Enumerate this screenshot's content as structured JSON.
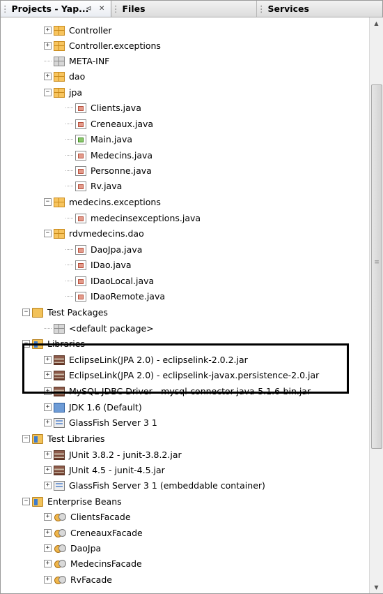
{
  "tabs": [
    {
      "label": "Projects - Yap...",
      "minimize": "⊲",
      "close": "✕"
    },
    {
      "label": "Files"
    },
    {
      "label": "Services"
    }
  ],
  "tree": [
    {
      "label": "Controller",
      "icon": "package-icon",
      "exp": "+"
    },
    {
      "label": "Controller.exceptions",
      "icon": "package-icon",
      "exp": "+"
    },
    {
      "label": "META-INF",
      "icon": "package-gray-icon",
      "exp": ""
    },
    {
      "label": "dao",
      "icon": "package-icon",
      "exp": "+"
    },
    {
      "label": "jpa",
      "icon": "package-icon",
      "exp": "−"
    },
    {
      "label": "Clients.java",
      "icon": "java-file-icon",
      "exp": ""
    },
    {
      "label": "Creneaux.java",
      "icon": "java-file-icon",
      "exp": ""
    },
    {
      "label": "Main.java",
      "icon": "java-main-file-icon",
      "exp": ""
    },
    {
      "label": "Medecins.java",
      "icon": "java-file-icon",
      "exp": ""
    },
    {
      "label": "Personne.java",
      "icon": "java-file-icon",
      "exp": ""
    },
    {
      "label": "Rv.java",
      "icon": "java-file-icon",
      "exp": ""
    },
    {
      "label": "medecins.exceptions",
      "icon": "package-icon",
      "exp": "−"
    },
    {
      "label": "medecinsexceptions.java",
      "icon": "java-file-icon",
      "exp": ""
    },
    {
      "label": "rdvmedecins.dao",
      "icon": "package-icon",
      "exp": "−"
    },
    {
      "label": "DaoJpa.java",
      "icon": "java-file-icon",
      "exp": ""
    },
    {
      "label": "IDao.java",
      "icon": "java-file-icon",
      "exp": ""
    },
    {
      "label": "IDaoLocal.java",
      "icon": "java-file-icon",
      "exp": ""
    },
    {
      "label": "IDaoRemote.java",
      "icon": "java-file-icon",
      "exp": ""
    },
    {
      "label": "Test Packages",
      "icon": "folder-icon",
      "exp": "−"
    },
    {
      "label": "<default package>",
      "icon": "package-gray-icon",
      "exp": ""
    },
    {
      "label": "Libraries",
      "icon": "libraries-folder-icon",
      "exp": "−"
    },
    {
      "label": "EclipseLink(JPA 2.0) - eclipselink-2.0.2.jar",
      "icon": "jar-icon",
      "exp": "+"
    },
    {
      "label": "EclipseLink(JPA 2.0) - eclipselink-javax.persistence-2.0.jar",
      "icon": "jar-icon",
      "exp": "+"
    },
    {
      "label": "MySQL JDBC Driver - mysql-connector-java-5.1.6-bin.jar",
      "icon": "jar-icon",
      "exp": "+"
    },
    {
      "label": "JDK 1.6 (Default)",
      "icon": "jdk-icon",
      "exp": "+"
    },
    {
      "label": "GlassFish Server 3 1",
      "icon": "server-icon",
      "exp": "+"
    },
    {
      "label": "Test Libraries",
      "icon": "libraries-folder-icon",
      "exp": "−"
    },
    {
      "label": "JUnit 3.8.2 - junit-3.8.2.jar",
      "icon": "jar-icon",
      "exp": "+"
    },
    {
      "label": "JUnit 4.5 - junit-4.5.jar",
      "icon": "jar-icon",
      "exp": "+"
    },
    {
      "label": "GlassFish Server 3 1 (embeddable container)",
      "icon": "server-icon",
      "exp": "+"
    },
    {
      "label": "Enterprise Beans",
      "icon": "beans-folder-icon",
      "exp": "−"
    },
    {
      "label": "ClientsFacade",
      "icon": "bean-icon",
      "exp": "+"
    },
    {
      "label": "CreneauxFacade",
      "icon": "bean-icon",
      "exp": "+"
    },
    {
      "label": "DaoJpa",
      "icon": "bean-icon",
      "exp": "+"
    },
    {
      "label": "MedecinsFacade",
      "icon": "bean-icon",
      "exp": "+"
    },
    {
      "label": "RvFacade",
      "icon": "bean-icon",
      "exp": "+"
    }
  ],
  "scrollbar": {
    "up": "▲",
    "down": "▼",
    "grip": "≡"
  }
}
